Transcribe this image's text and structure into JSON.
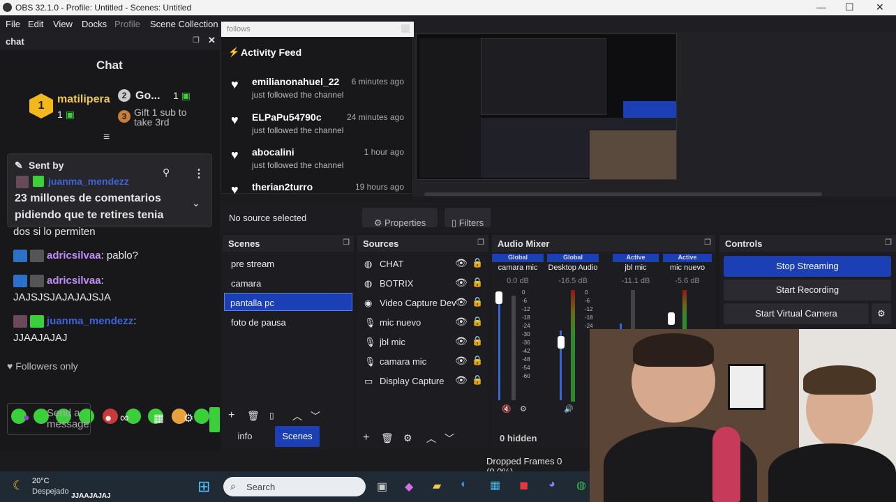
{
  "window": {
    "title": "OBS 32.1.0 - Profile: Untitled - Scenes: Untitled",
    "minimize": "—",
    "maximize": "☐",
    "close": "✕"
  },
  "menu": [
    "File",
    "Edit",
    "View",
    "Docks",
    "Profile",
    "Scene Collection"
  ],
  "chat_dock": {
    "dock_title": "chat",
    "heading": "Chat",
    "leader": {
      "rank": "1",
      "name": "matilipera",
      "count": "1"
    },
    "second": {
      "rank": "2",
      "name": "Go...",
      "count": "1"
    },
    "third": {
      "rank": "3",
      "text": "Gift 1 sub to take 3rd"
    },
    "pinned": {
      "label": "Sent by",
      "user": "juanma_mendezz",
      "message": "23 millones de comentarios pidiendo que te retires tenia"
    },
    "messages": [
      {
        "user": "",
        "text": "dos si lo permiten"
      },
      {
        "user": "adricsilvaa",
        "text": ": pablo?"
      },
      {
        "user": "adricsilvaa",
        "text": ":"
      },
      {
        "user": "",
        "text": "JAJSJSJAJAJAJSJA"
      },
      {
        "user": "juanma_mendezz",
        "text": ":"
      },
      {
        "user": "",
        "text": "JJAAJAJAJ"
      }
    ],
    "followers_only": "Followers only",
    "send_placeholder": "Send a message",
    "infinity": "∞"
  },
  "follows_window": {
    "title": "follows",
    "feed_title": "Activity Feed",
    "items": [
      {
        "user": "emilianonahuel_22",
        "time": "6 minutes ago",
        "action": "just followed the channel"
      },
      {
        "user": "ELPaPu54790c",
        "time": "24 minutes ago",
        "action": "just followed the channel"
      },
      {
        "user": "abocalini",
        "time": "1 hour ago",
        "action": "just followed the channel"
      },
      {
        "user": "therian2turro",
        "time": "19 hours ago",
        "action": ""
      }
    ]
  },
  "source_toolbar": {
    "no_source": "No source selected",
    "properties": "Properties",
    "filters": "Filters"
  },
  "scenes": {
    "title": "Scenes",
    "items": [
      "pre stream",
      "camara",
      "pantalla pc",
      "foto de pausa"
    ],
    "selected": "pantalla pc",
    "tabs": [
      "info",
      "Scenes"
    ],
    "active_tab": "Scenes"
  },
  "sources": {
    "title": "Sources",
    "items": [
      {
        "name": "CHAT",
        "icon": "browser-icon"
      },
      {
        "name": "BOTRIX",
        "icon": "browser-icon"
      },
      {
        "name": "Video Capture Dev",
        "icon": "camera-icon"
      },
      {
        "name": "mic nuevo",
        "icon": "microphone-icon"
      },
      {
        "name": "jbl mic",
        "icon": "microphone-icon"
      },
      {
        "name": "camara mic",
        "icon": "microphone-icon"
      },
      {
        "name": "Display Capture",
        "icon": "monitor-icon"
      }
    ]
  },
  "audio_mixer": {
    "title": "Audio Mixer",
    "channels": [
      {
        "tag": "Global",
        "name": "camara mic",
        "db": "0.0 dB"
      },
      {
        "tag": "Global",
        "name": "Desktop Audio",
        "db": "-16.5 dB"
      },
      {
        "tag": "Active",
        "name": "jbl mic",
        "db": "-11.1 dB"
      },
      {
        "tag": "Active",
        "name": "mic nuevo",
        "db": "-5.6 dB"
      }
    ],
    "scale": [
      "0",
      "-6",
      "-12",
      "-18",
      "-24",
      "-30",
      "-36",
      "-42",
      "-48",
      "-54",
      "-60"
    ],
    "hidden": "0 hidden"
  },
  "controls": {
    "title": "Controls",
    "stop_streaming": "Stop Streaming",
    "start_recording": "Start Recording",
    "start_virtual_camera": "Start Virtual Camera"
  },
  "status": {
    "dropped_frames": "Dropped Frames 0 (0.0%)"
  },
  "taskbar": {
    "temperature": "20°C",
    "weather": "Despejado",
    "search": "Search",
    "ticker": "JJAAJAJAJ"
  },
  "colors": {
    "accent": "#1b3fb4",
    "chat_green": "#3ccf3c",
    "username_blue": "#3e63d8",
    "username_purple": "#c28cff",
    "stream_button": "#1b3fb4"
  }
}
